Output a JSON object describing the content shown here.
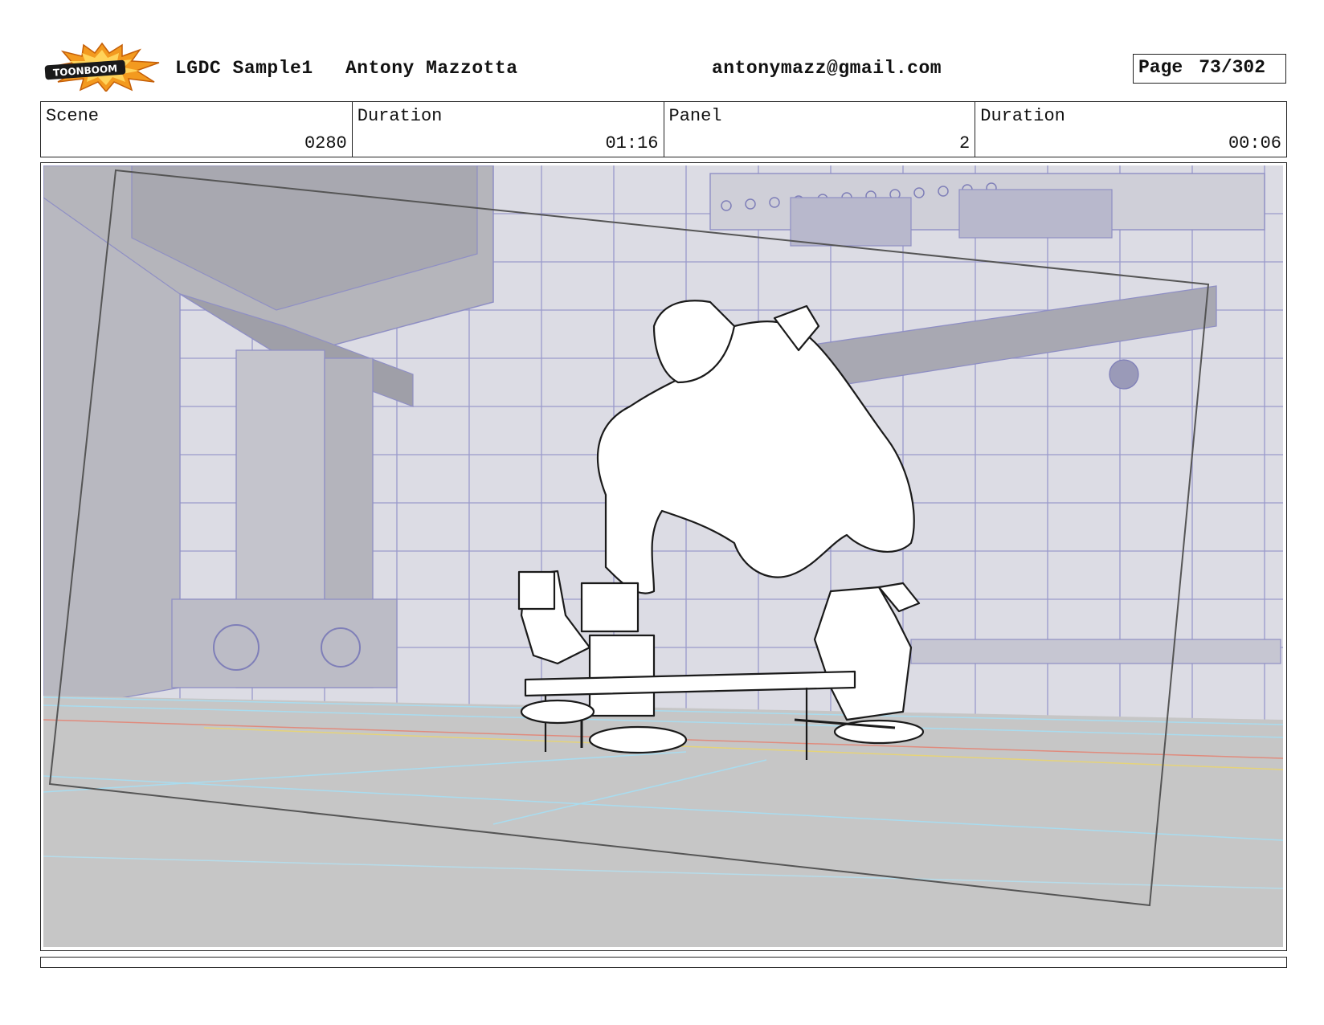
{
  "header": {
    "logo_text": "TOONBOOM",
    "project": "LGDC Sample1",
    "author": "Antony Mazzotta",
    "email": "antonymazz@gmail.com",
    "page_label": "Page",
    "page_value": "73/302"
  },
  "info": {
    "scene_label": "Scene",
    "scene_value": "0280",
    "scene_duration_label": "Duration",
    "scene_duration_value": "01:16",
    "panel_label": "Panel",
    "panel_value": "2",
    "panel_duration_label": "Duration",
    "panel_duration_value": "00:06"
  },
  "colors": {
    "wireframe": "#8f8fc4",
    "floor_cyan": "#a9dcef",
    "floor_red": "#e08b7d",
    "floor_yellow": "#e5d37a",
    "background_gray": "#c6c6c6"
  }
}
